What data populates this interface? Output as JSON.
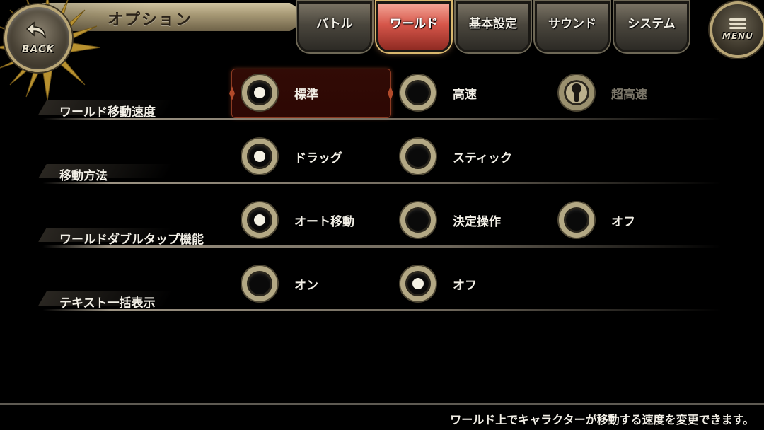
{
  "header": {
    "title": "オプション",
    "back_label": "BACK",
    "menu_label": "MENU",
    "tabs": [
      {
        "label": "バトル",
        "active": false
      },
      {
        "label": "ワールド",
        "active": true
      },
      {
        "label": "基本設定",
        "active": false
      },
      {
        "label": "サウンド",
        "active": false
      },
      {
        "label": "システム",
        "active": false
      }
    ]
  },
  "settings": [
    {
      "label": "ワールド移動速度",
      "options": [
        {
          "label": "標準",
          "state": "selected"
        },
        {
          "label": "高速",
          "state": "unselected"
        },
        {
          "label": "超高速",
          "state": "locked"
        }
      ]
    },
    {
      "label": "移動方法",
      "options": [
        {
          "label": "ドラッグ",
          "state": "selected"
        },
        {
          "label": "スティック",
          "state": "unselected"
        }
      ]
    },
    {
      "label": "ワールドダブルタップ機能",
      "options": [
        {
          "label": "オート移動",
          "state": "selected"
        },
        {
          "label": "決定操作",
          "state": "unselected"
        },
        {
          "label": "オフ",
          "state": "unselected"
        }
      ]
    },
    {
      "label": "テキスト一括表示",
      "options": [
        {
          "label": "オン",
          "state": "unselected"
        },
        {
          "label": "オフ",
          "state": "selected"
        }
      ]
    }
  ],
  "footer": {
    "help_text": "ワールド上でキャラクターが移動する速度を変更できます。"
  },
  "colors": {
    "accent_active_tab": "#d6564a",
    "radio_ring": "#b3a884",
    "highlight_row": "#5a140a"
  }
}
